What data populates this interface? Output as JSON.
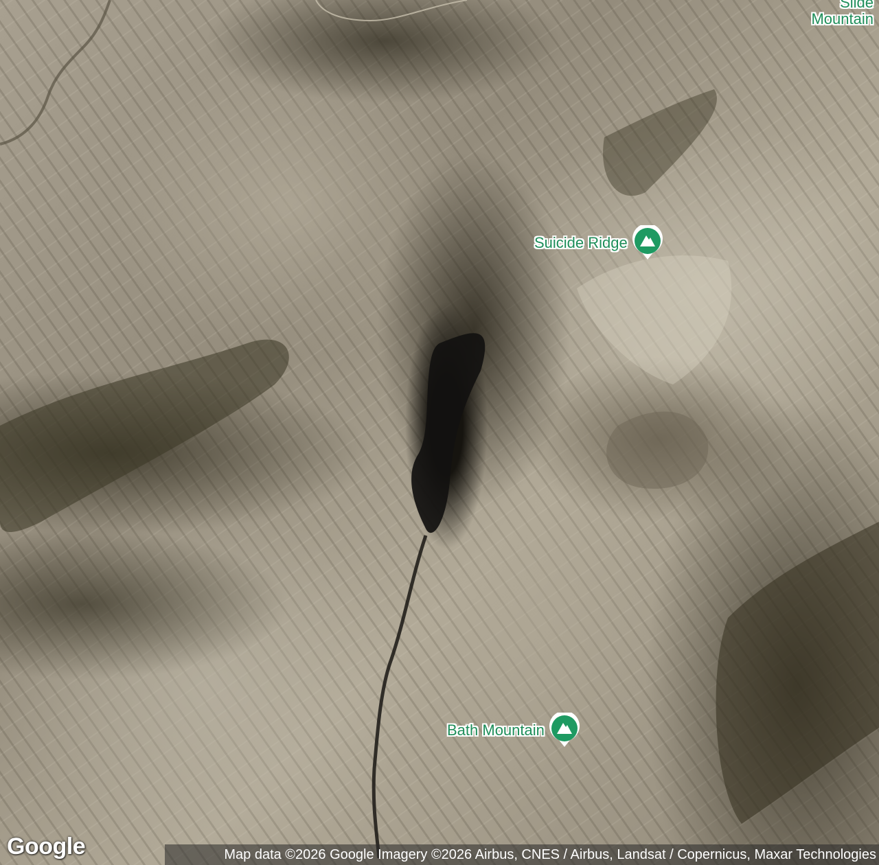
{
  "map": {
    "type": "satellite",
    "colors": {
      "label": "#1e8e5a",
      "pin": "#1e9a62",
      "pin_icon": "#ffffff"
    },
    "places": [
      {
        "label": "Suicide Ridge",
        "icon": "mountain-peak-icon"
      },
      {
        "label": "Bath Mountain",
        "icon": "mountain-peak-icon"
      }
    ],
    "corner_place": {
      "line1": "Slide",
      "line2": "Mountain"
    }
  },
  "footer": {
    "logo_text": "Google",
    "attribution": "Map data ©2026 Google Imagery ©2026 Airbus, CNES / Airbus, Landsat / Copernicus, Maxar Technologies"
  }
}
